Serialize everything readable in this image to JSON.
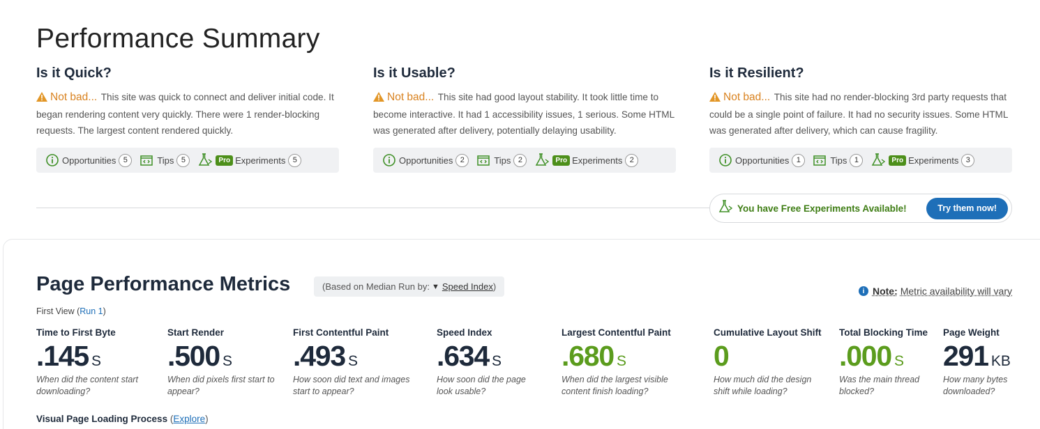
{
  "summary": {
    "title": "Performance Summary"
  },
  "columns": [
    {
      "heading": "Is it Quick?",
      "verdict": "Not bad...",
      "text": "This site was quick to connect and deliver initial code. It began rendering content very quickly. There were 1 render-blocking requests. The largest content rendered quickly.",
      "pills": {
        "opportunities_label": "Opportunities",
        "opportunities": "5",
        "tips_label": "Tips",
        "tips": "5",
        "pro": "Pro",
        "experiments_label": "Experiments",
        "experiments": "5"
      }
    },
    {
      "heading": "Is it Usable?",
      "verdict": "Not bad...",
      "text": "This site had good layout stability. It took little time to become interactive. It had 1 accessibility issues, 1 serious. Some HTML was generated after delivery, potentially delaying usability.",
      "pills": {
        "opportunities_label": "Opportunities",
        "opportunities": "2",
        "tips_label": "Tips",
        "tips": "2",
        "pro": "Pro",
        "experiments_label": "Experiments",
        "experiments": "2"
      }
    },
    {
      "heading": "Is it Resilient?",
      "verdict": "Not bad...",
      "text": "This site had no render-blocking 3rd party requests that could be a single point of failure. It had no security issues. Some HTML was generated after delivery, which can cause fragility.",
      "pills": {
        "opportunities_label": "Opportunities",
        "opportunities": "1",
        "tips_label": "Tips",
        "tips": "1",
        "pro": "Pro",
        "experiments_label": "Experiments",
        "experiments": "3"
      }
    }
  ],
  "experiments_banner": {
    "text": "You have Free Experiments Available!",
    "button": "Try them now!"
  },
  "metrics": {
    "title": "Page Performance Metrics",
    "median_prefix": "(Based on Median Run by:",
    "median_arrow": "▼",
    "median_link": "Speed Index",
    "median_suffix": ")",
    "note_label": "Note:",
    "note_text": "Metric availability will vary",
    "first_view": "First View (",
    "run_link": "Run 1",
    "first_view_close": ")",
    "items": [
      {
        "label": "Time to First Byte",
        "value": ".145",
        "unit": "S",
        "desc": "When did the content start downloading?"
      },
      {
        "label": "Start Render",
        "value": ".500",
        "unit": "S",
        "desc": "When did pixels first start to appear?"
      },
      {
        "label": "First Contentful Paint",
        "value": ".493",
        "unit": "S",
        "desc": "How soon did text and images start to appear?"
      },
      {
        "label": "Speed Index",
        "value": ".634",
        "unit": "S",
        "desc": "How soon did the page look usable?"
      },
      {
        "label": "Largest Contentful Paint",
        "value": ".680",
        "unit": "S",
        "desc": "When did the largest visible content finish loading?"
      },
      {
        "label": "Cumulative Layout Shift",
        "value": "0",
        "unit": "",
        "desc": "How much did the design shift while loading?"
      },
      {
        "label": "Total Blocking Time",
        "value": ".000",
        "unit": "S",
        "desc": "Was the main thread blocked?"
      },
      {
        "label": "Page Weight",
        "value": "291",
        "unit": "KB",
        "desc": "How many bytes downloaded?"
      }
    ],
    "visual_label": "Visual Page Loading Process",
    "explore_open": "(",
    "explore_link": "Explore",
    "explore_close": ")"
  },
  "colors": {
    "accent": "#1e6fb8",
    "good": "#5b9c1d",
    "warning": "#d9821f",
    "pro": "#4d8f1a"
  }
}
